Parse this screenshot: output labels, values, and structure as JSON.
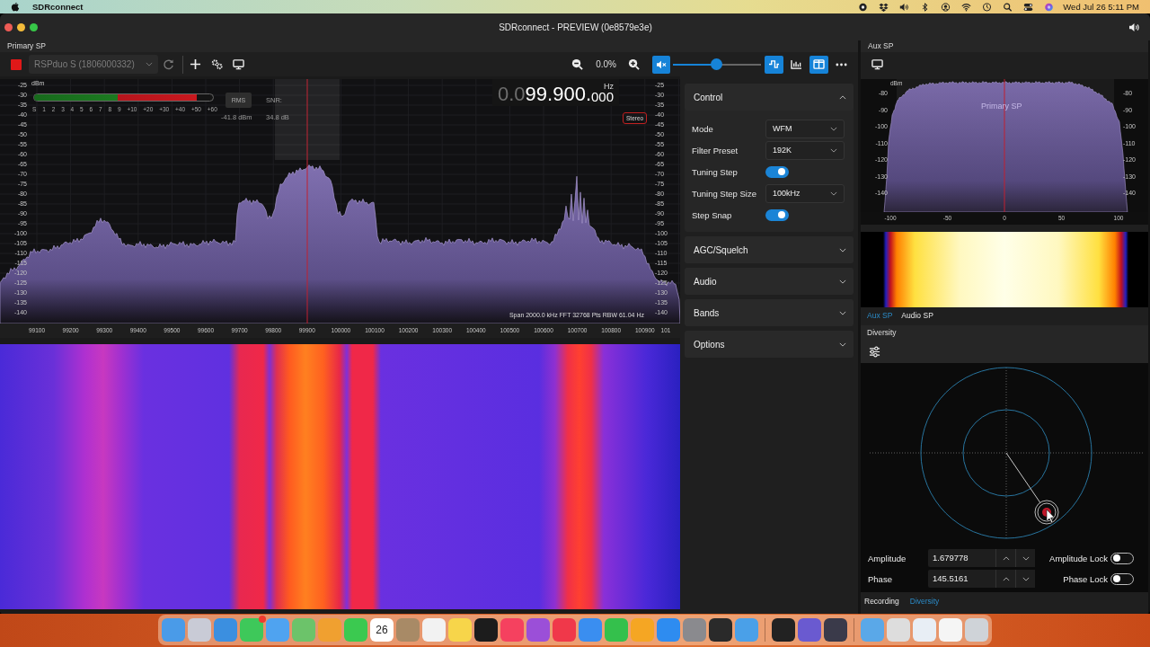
{
  "menu_bar": {
    "app_name": "SDRconnect",
    "clock": "Wed Jul 26 5:11 PM"
  },
  "window": {
    "title": "SDRconnect - PREVIEW (0e8579e3e)"
  },
  "primary_sp": {
    "title": "Primary SP",
    "toolbar": {
      "device": "RSPduo S (1806000332)",
      "zoom": "0.0%",
      "muted": true,
      "volume": {
        "level": 0.49
      },
      "view_buttons": [
        {
          "kind": "spectrum",
          "selected": true
        },
        {
          "kind": "bars",
          "selected": false
        },
        {
          "kind": "split",
          "selected": true
        }
      ]
    },
    "spectrum": {
      "unit": "dBm",
      "y_labels": [
        "-25",
        "-30",
        "-35",
        "-40",
        "-45",
        "-50",
        "-55",
        "-60",
        "-65",
        "-70",
        "-75",
        "-80",
        "-85",
        "-90",
        "-95",
        "-100",
        "-105",
        "-110",
        "-115",
        "-120",
        "-125",
        "-130",
        "-135",
        "-140"
      ],
      "right_y_labels": [
        "-25",
        "-30",
        "-35",
        "-40",
        "-45",
        "-50",
        "-55",
        "-60",
        "-65",
        "-70",
        "-75",
        "-80",
        "-85",
        "-90",
        "-95",
        "-100",
        "-105",
        "-110",
        "-115",
        "-120",
        "-125",
        "-130",
        "-135",
        "-140"
      ],
      "x_labels": [
        "99100",
        "99200",
        "99300",
        "99400",
        "99500",
        "99600",
        "99700",
        "99800",
        "99900",
        "100000",
        "100100",
        "100200",
        "100300",
        "100400",
        "100500",
        "100600",
        "100700",
        "100800",
        "100900",
        "101"
      ],
      "s_meter": {
        "level": 0.91,
        "scale": [
          "S",
          "1",
          "2",
          "3",
          "4",
          "5",
          "6",
          "7",
          "8",
          "9",
          "+10",
          "+20",
          "+30",
          "+40",
          "+50",
          "+60"
        ]
      },
      "rms_button": "RMS",
      "rms_value": "-41.8 dBm",
      "snr_label": "SNR:",
      "snr_value": "34.8 dB",
      "frequency": {
        "dim": "0.0",
        "main": "99.900.",
        "fine": "000",
        "unit": "Hz"
      },
      "stereo_badge": "Stereo",
      "status": "Span 2000.0 kHz FFT 32768 Pts RBW 61.04 Hz"
    },
    "control_panel": [
      {
        "title": "Control",
        "expanded": true,
        "rows": [
          {
            "kind": "dropdown",
            "label": "Mode",
            "value": "WFM"
          },
          {
            "kind": "dropdown",
            "label": "Filter Preset",
            "value": "192K"
          },
          {
            "kind": "toggle",
            "label": "Tuning Step",
            "on": true
          },
          {
            "kind": "dropdown",
            "label": "Tuning Step Size",
            "value": "100kHz"
          },
          {
            "kind": "toggle",
            "label": "Step Snap",
            "on": true
          }
        ]
      },
      {
        "title": "AGC/Squelch",
        "expanded": false
      },
      {
        "title": "Audio",
        "expanded": false
      },
      {
        "title": "Bands",
        "expanded": false
      },
      {
        "title": "Options",
        "expanded": false
      }
    ]
  },
  "aux_sp": {
    "title": "Aux SP",
    "spectrum": {
      "unit": "dBm",
      "y_labels": [
        "-80",
        "-90",
        "-100",
        "-110",
        "-120",
        "-130",
        "-140"
      ],
      "right_y_labels": [
        "-80",
        "-90",
        "-100",
        "-110",
        "-120",
        "-130",
        "-140"
      ],
      "x_labels": [
        "-100",
        "-50",
        "0",
        "50",
        "100"
      ],
      "overlay_label": "Primary SP"
    },
    "tabs": [
      {
        "label": "Aux SP",
        "selected": true
      },
      {
        "label": "Audio SP",
        "selected": false
      }
    ]
  },
  "diversity": {
    "title": "Diversity",
    "fields": [
      {
        "label": "Amplitude",
        "value": "1.679778",
        "lock_label": "Amplitude Lock",
        "locked": false
      },
      {
        "label": "Phase",
        "value": "145.5161",
        "lock_label": "Phase Lock",
        "locked": false
      }
    ],
    "tabs": [
      {
        "label": "Recording",
        "selected": false
      },
      {
        "label": "Diversity",
        "selected": true
      }
    ]
  },
  "dock": [
    {
      "kind": "app",
      "color": "#4a9be8",
      "badge": false
    },
    {
      "kind": "app",
      "color": "#c9cbd6",
      "badge": false
    },
    {
      "kind": "app",
      "color": "#3b8fe0",
      "badge": false
    },
    {
      "kind": "app",
      "color": "#3ec85a",
      "badge": true
    },
    {
      "kind": "app",
      "color": "#4fa3f0",
      "badge": false
    },
    {
      "kind": "app",
      "color": "#6cc36a",
      "badge": false
    },
    {
      "kind": "app",
      "color": "#f0a030",
      "badge": false
    },
    {
      "kind": "app",
      "color": "#3bc950",
      "badge": false
    },
    {
      "kind": "calendar",
      "label": "26",
      "color": "#ffffff",
      "badge": false
    },
    {
      "kind": "app",
      "color": "#a88a66",
      "badge": false
    },
    {
      "kind": "app",
      "color": "#f2f2f2",
      "badge": false
    },
    {
      "kind": "app",
      "color": "#f7d54a",
      "badge": false
    },
    {
      "kind": "app",
      "color": "#1c1c1c",
      "badge": false
    },
    {
      "kind": "app",
      "color": "#f5415f",
      "badge": false
    },
    {
      "kind": "app",
      "color": "#9b4fd8",
      "badge": false
    },
    {
      "kind": "app",
      "color": "#f0384a",
      "badge": false
    },
    {
      "kind": "app",
      "color": "#3a8ef0",
      "badge": false
    },
    {
      "kind": "app",
      "color": "#34c04c",
      "badge": false
    },
    {
      "kind": "app",
      "color": "#f5a623",
      "badge": false
    },
    {
      "kind": "app",
      "color": "#2e8cf0",
      "badge": false
    },
    {
      "kind": "app",
      "color": "#8a8a8e",
      "badge": false
    },
    {
      "kind": "app",
      "color": "#2a2a2a",
      "badge": false
    },
    {
      "kind": "app",
      "color": "#4aa0e8",
      "badge": false
    },
    {
      "kind": "divider"
    },
    {
      "kind": "app",
      "color": "#222222",
      "badge": false
    },
    {
      "kind": "app",
      "color": "#6a5ad0",
      "badge": false
    },
    {
      "kind": "app",
      "color": "#3a3a4a",
      "badge": false
    },
    {
      "kind": "divider"
    },
    {
      "kind": "app",
      "color": "#5aa8e8",
      "badge": false
    },
    {
      "kind": "app",
      "color": "#dddddd",
      "badge": false
    },
    {
      "kind": "app",
      "color": "#e8eef5",
      "badge": false
    },
    {
      "kind": "app",
      "color": "#f5f5f5",
      "badge": false
    },
    {
      "kind": "app",
      "color": "#cfd3d8",
      "badge": false
    }
  ]
}
